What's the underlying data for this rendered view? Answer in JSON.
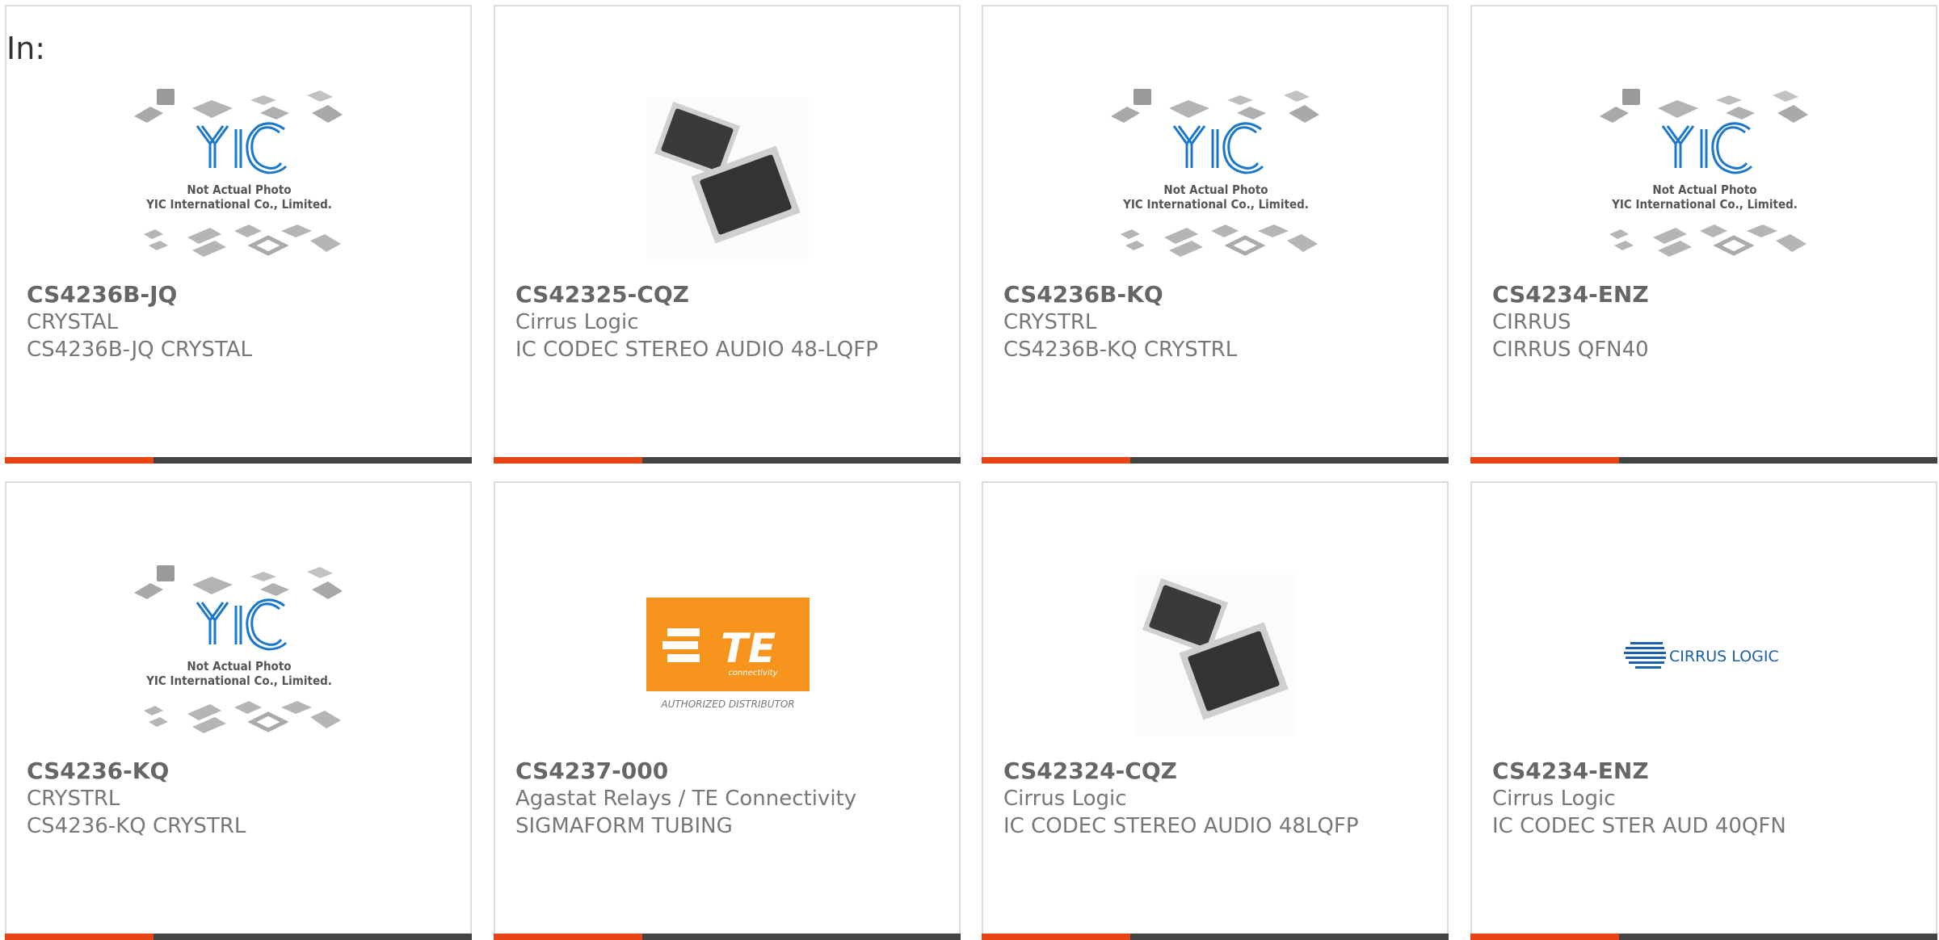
{
  "header": {
    "label": "In:"
  },
  "yic_image": {
    "line1": "Not Actual Photo",
    "line2": "YIC International Co., Limited.",
    "logo_text": "YIC"
  },
  "te_image": {
    "logo_text": "TE",
    "sub_text": "connectivity",
    "caption": "AUTHORIZED DISTRIBUTOR"
  },
  "cirrus_image": {
    "logo_text": "CIRRUS LOGIC"
  },
  "colors": {
    "accent": "#e94414",
    "bar": "#444444",
    "te_orange": "#f7941d",
    "cirrus_blue": "#1b5fae"
  },
  "products": [
    {
      "part_number": "CS4236B-JQ",
      "manufacturer": "CRYSTAL",
      "description": "CS4236B-JQ CRYSTAL",
      "image": "yic-placeholder"
    },
    {
      "part_number": "CS42325-CQZ",
      "manufacturer": "Cirrus Logic",
      "description": "IC CODEC STEREO AUDIO 48-LQFP",
      "image": "qfp-chip"
    },
    {
      "part_number": "CS4236B-KQ",
      "manufacturer": "CRYSTRL",
      "description": "CS4236B-KQ CRYSTRL",
      "image": "yic-placeholder"
    },
    {
      "part_number": "CS4234-ENZ",
      "manufacturer": "CIRRUS",
      "description": "CIRRUS QFN40",
      "image": "yic-placeholder"
    },
    {
      "part_number": "CS4236-KQ",
      "manufacturer": "CRYSTRL",
      "description": "CS4236-KQ CRYSTRL",
      "image": "yic-placeholder"
    },
    {
      "part_number": "CS4237-000",
      "manufacturer": "Agastat Relays / TE Connectivity",
      "description": "SIGMAFORM TUBING",
      "image": "te-logo"
    },
    {
      "part_number": "CS42324-CQZ",
      "manufacturer": "Cirrus Logic",
      "description": "IC CODEC STEREO AUDIO 48LQFP",
      "image": "qfp-chip"
    },
    {
      "part_number": "CS4234-ENZ",
      "manufacturer": "Cirrus Logic",
      "description": "IC CODEC STER AUD 40QFN",
      "image": "cirrus-logo"
    }
  ]
}
